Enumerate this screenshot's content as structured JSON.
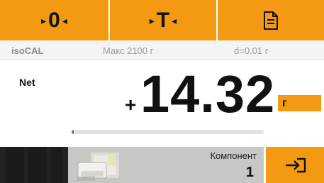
{
  "toolbar": {
    "zero_button": {
      "glyph": "0",
      "left_marker": "▸",
      "right_marker": "◂",
      "icon": "zero-icon"
    },
    "tare_button": {
      "glyph": "T",
      "left_marker": "▸",
      "right_marker": "◂",
      "icon": "tare-icon"
    },
    "document_button": {
      "icon": "document-icon"
    },
    "accent_color": "#f39a12"
  },
  "info": {
    "brand": "isoCAL",
    "max_capacity": "Макс 2100 г",
    "readability": "d=0.01 г"
  },
  "reading": {
    "mode_label": "Net",
    "sign": "+",
    "value": "14.32",
    "unit": "г",
    "capacity_used_fraction": 0.01
  },
  "bottom": {
    "component_label": "Компонент",
    "component_number": "1",
    "thumbnail_icon": "component-image",
    "enter_icon": "enter-icon"
  }
}
